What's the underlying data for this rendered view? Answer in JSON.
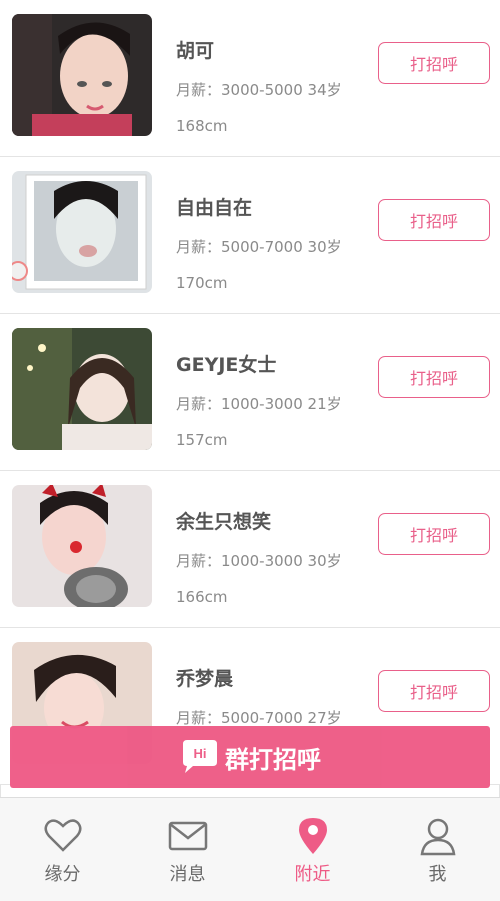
{
  "colors": {
    "accent": "#ee5b86",
    "text_dark": "#555555",
    "text_muted": "#8a8a8a"
  },
  "people": [
    {
      "name": "胡可",
      "info": "月薪：3000-5000 34岁",
      "height": "168cm",
      "greet": "打招呼"
    },
    {
      "name": "自由自在",
      "info": "月薪：5000-7000 30岁",
      "height": "170cm",
      "greet": "打招呼"
    },
    {
      "name": "GEYJE女士",
      "info": "月薪：1000-3000 21岁",
      "height": "157cm",
      "greet": "打招呼"
    },
    {
      "name": "余生只想笑",
      "info": "月薪：1000-3000 30岁",
      "height": "166cm",
      "greet": "打招呼"
    },
    {
      "name": "乔梦晨",
      "info": "月薪：5000-7000 27岁",
      "height": "",
      "greet": "打招呼"
    }
  ],
  "group_greet": {
    "badge": "Hi",
    "label": "群打招呼"
  },
  "tabs": [
    {
      "label": "缘分",
      "icon": "heart-icon"
    },
    {
      "label": "消息",
      "icon": "envelope-icon"
    },
    {
      "label": "附近",
      "icon": "location-pin-icon",
      "active": true
    },
    {
      "label": "我",
      "icon": "person-icon"
    }
  ]
}
